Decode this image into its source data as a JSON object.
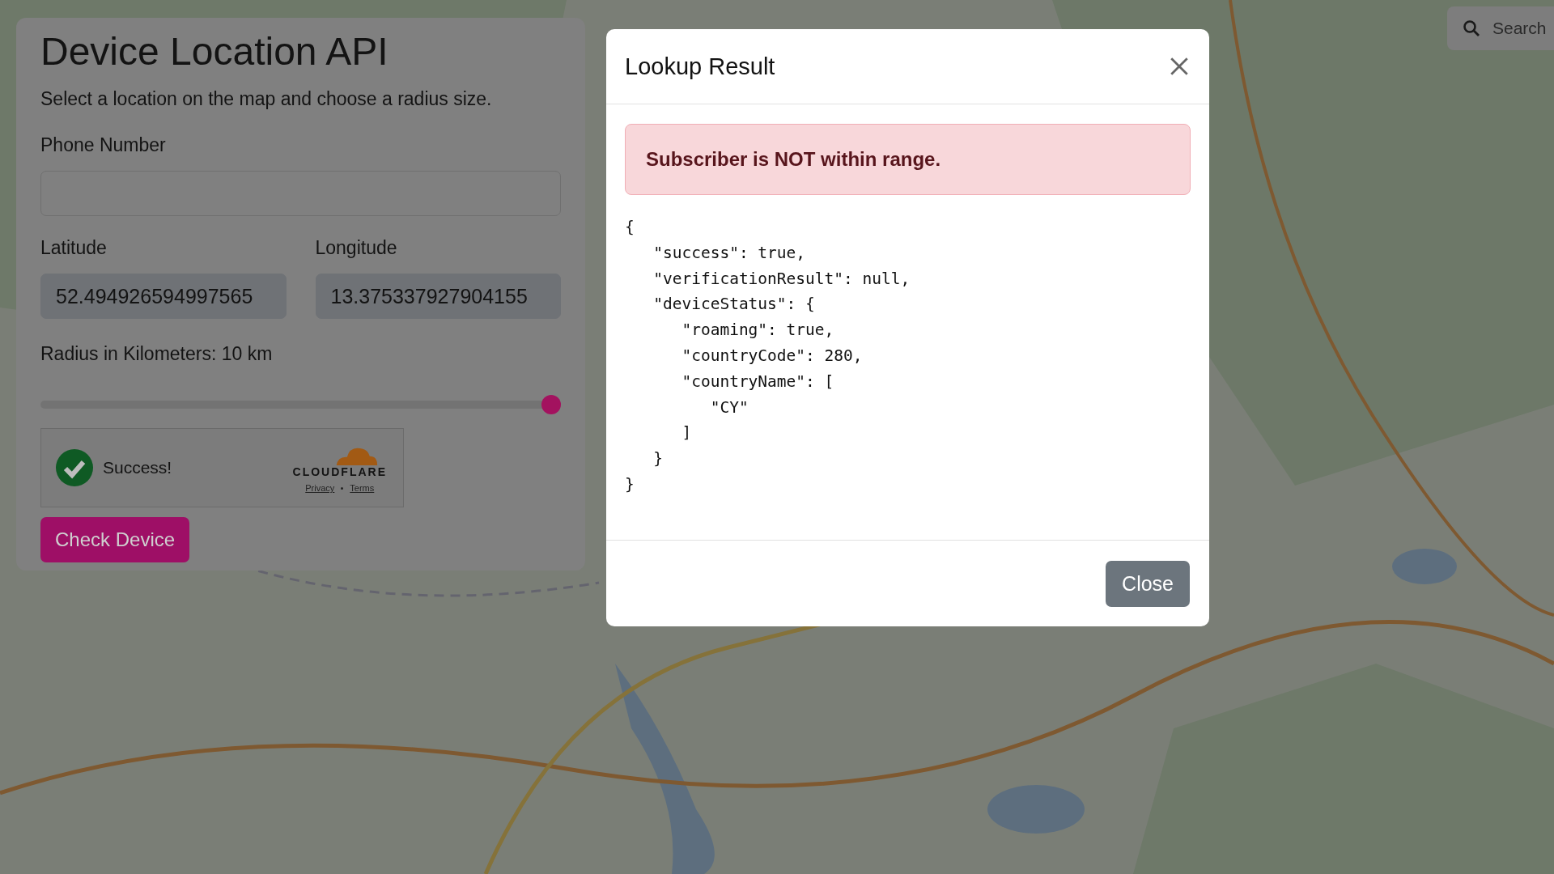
{
  "panel": {
    "title": "Device Location API",
    "subtitle": "Select a location on the map and choose a radius size.",
    "phone": {
      "label": "Phone Number"
    },
    "latitude": {
      "label": "Latitude",
      "value": "52.494926594997565"
    },
    "longitude": {
      "label": "Longitude",
      "value": "13.375337927904155"
    },
    "radius": {
      "label": "Radius in Kilometers: 10 km",
      "level": 1
    },
    "captcha": {
      "checked": true,
      "status": "Success!",
      "brand": "CLOUDFLARE",
      "links": [
        "Privacy",
        "Terms"
      ]
    },
    "submit": "Check Device"
  },
  "map_search": {
    "placeholder": "Search"
  },
  "modal": {
    "title": "Lookup Result",
    "alert": {
      "kind": "danger",
      "text": "Subscriber is NOT within range."
    },
    "response": "{\n   \"success\": true,\n   \"verificationResult\": null,\n   \"deviceStatus\": {\n      \"roaming\": true,\n      \"countryCode\": 280,\n      \"countryName\": [\n         \"CY\"\n      ]\n   }\n}",
    "buttons": [
      "Close"
    ]
  }
}
